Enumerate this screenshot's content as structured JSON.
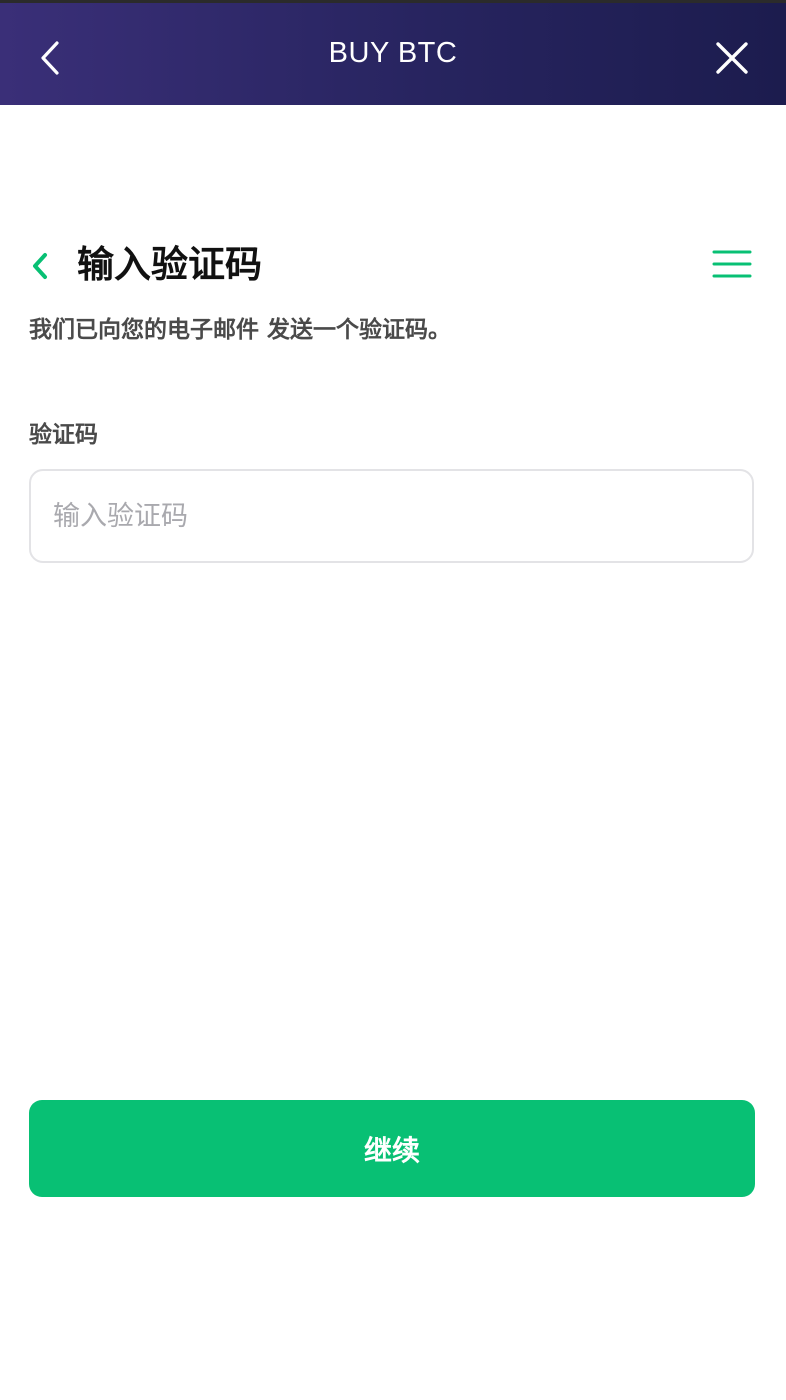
{
  "header": {
    "title": "BUY BTC",
    "back_icon": "chevron-left-icon",
    "close_icon": "close-icon"
  },
  "section": {
    "title": "输入验证码",
    "subtitle": "我们已向您的电子邮件 发送一个验证码。",
    "back_icon": "chevron-left-icon",
    "menu_icon": "hamburger-menu-icon"
  },
  "form": {
    "code_label": "验证码",
    "code_value": "",
    "code_placeholder": "输入验证码"
  },
  "actions": {
    "continue_label": "继续"
  },
  "colors": {
    "header_gradient_start": "#3a2f78",
    "header_gradient_end": "#1c1c4e",
    "accent_green": "#08c074",
    "input_border": "#e3e3e6"
  }
}
